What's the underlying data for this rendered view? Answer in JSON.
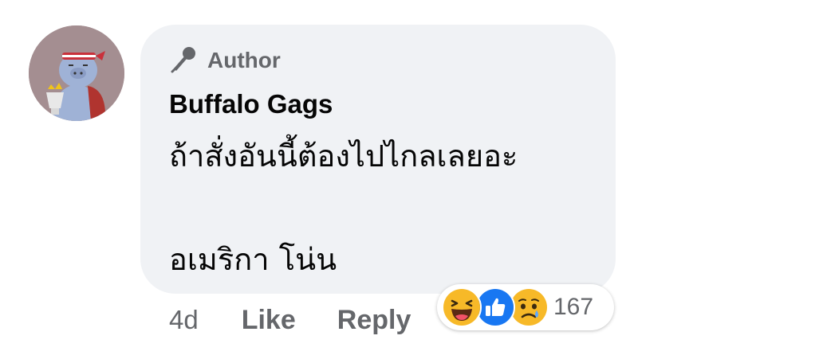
{
  "comment": {
    "badge_label": "Author",
    "author_name": "Buffalo Gags",
    "text_line1": "ถ้าสั่งอันนี้ต้องไปไกลเลยอะ",
    "text_line2": "อเมริกา โน่น",
    "time": "4d",
    "like_label": "Like",
    "reply_label": "Reply",
    "reactions": {
      "icons": [
        "haha-icon",
        "like-icon",
        "sad-icon"
      ],
      "count": "167"
    },
    "colors": {
      "bubble": "#f0f2f5",
      "meta_text": "#65676b",
      "like_blue": "#1877f2",
      "emoji_yellow": "#f7b928"
    }
  }
}
